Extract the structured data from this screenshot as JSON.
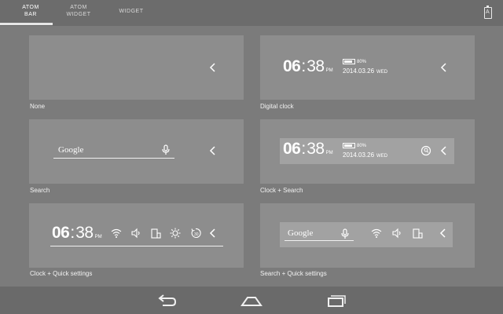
{
  "tabs": [
    {
      "label_line1": "ATOM",
      "label_line2": "BAR"
    },
    {
      "label_line1": "ATOM",
      "label_line2": "WIDGET"
    },
    {
      "label_line1": "WIDGET",
      "label_line2": ""
    }
  ],
  "top_icon": {
    "name": "store-icon",
    "letter": "A"
  },
  "cards": [
    {
      "caption": "None"
    },
    {
      "caption": "Digital clock"
    },
    {
      "caption": "Search"
    },
    {
      "caption": "Clock + Search"
    },
    {
      "caption": "Clock + Quick settings"
    },
    {
      "caption": "Search + Quick settings"
    }
  ],
  "clock": {
    "hour": "06",
    "minute": "38",
    "ampm": "PM",
    "battery": "80%",
    "date": "2014.03.26",
    "weekday": "WED"
  },
  "search": {
    "brand": "Google"
  },
  "icons": [
    "chevron-left-icon",
    "mic-icon",
    "search-icon",
    "wifi-icon",
    "volume-icon",
    "rotation-icon",
    "brightness-icon",
    "sync-icon",
    "back-icon",
    "home-icon",
    "recents-icon"
  ],
  "colors": {
    "background": "#7b7b7b",
    "card": "#8d8d8d",
    "bars": "#6c6c6c",
    "text": "#ffffff"
  }
}
